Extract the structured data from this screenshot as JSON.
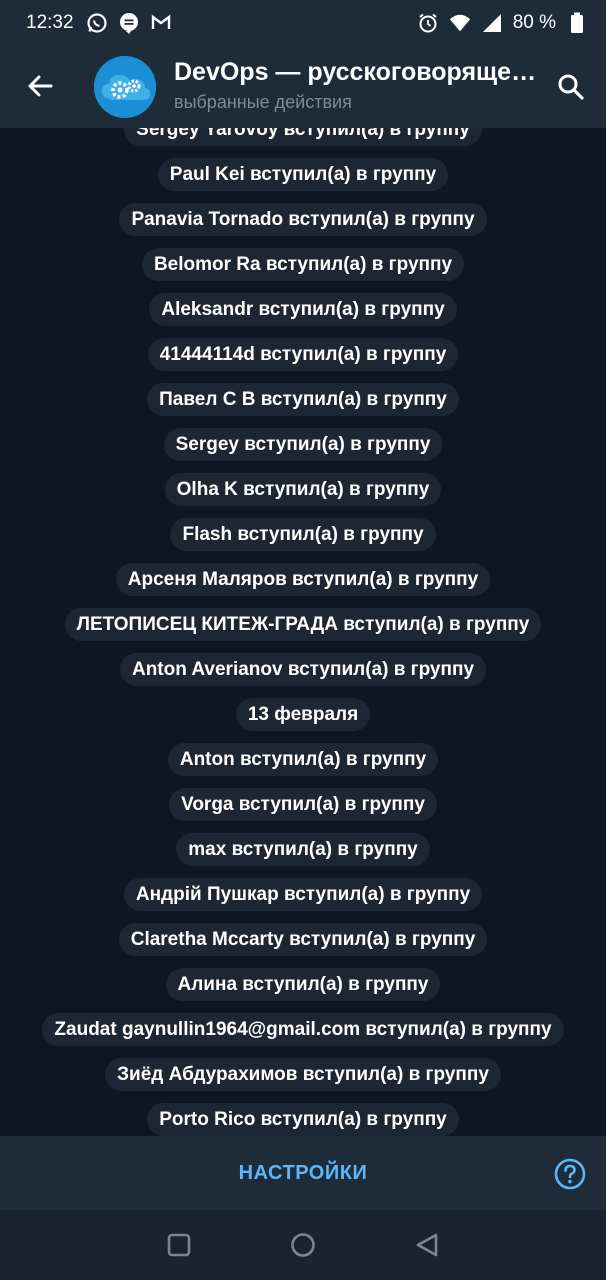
{
  "status_bar": {
    "time": "12:32",
    "battery_text": "80 %",
    "left_icons": [
      "whatsapp-icon",
      "chat-bubble-icon",
      "gmail-icon"
    ],
    "right_icons": [
      "alarm-icon",
      "wifi-icon",
      "signal-icon",
      "battery-icon"
    ]
  },
  "header": {
    "title": "DevOps — русскоговорящее сообщество",
    "subtitle": "выбранные действия",
    "avatar_color": "#1b8fd6"
  },
  "messages": [
    "Sergey Yarovoy вступил(а) в группу",
    "Paul Kei вступил(а) в группу",
    "Panavia Tornado вступил(а) в группу",
    "Belomor Ra вступил(а) в группу",
    "Aleksandr вступил(а) в группу",
    "41444114d вступил(а) в группу",
    "Павел С В вступил(а) в группу",
    "Sergey вступил(а) в группу",
    "Olha K вступил(а) в группу",
    "Flash вступил(а) в группу",
    "Арсеня Маляров вступил(а) в группу",
    "ЛЕТОПИСЕЦ КИТЕЖ-ГРАДА вступил(а) в группу",
    "Anton Averianov вступил(а) в группу",
    "13 февраля",
    "Anton вступил(а) в группу",
    "Vorga вступил(а) в группу",
    "max вступил(а) в группу",
    "Андрій Пушкар вступил(а) в группу",
    "Claretha Mccarty вступил(а) в группу",
    "Алина вступил(а) в группу",
    "Zaudat gaynullin1964@gmail.com вступил(а) в группу",
    "Зиёд Абдурахимов вступил(а) в группу",
    "Porto Rico вступил(а) в группу"
  ],
  "bottom_bar": {
    "settings_label": "НАСТРОЙКИ",
    "help_icon": "help-icon"
  },
  "colors": {
    "background": "#0e1621",
    "header": "#1e2c3a",
    "pill": "#1d2733",
    "accent": "#5eb5f7"
  }
}
